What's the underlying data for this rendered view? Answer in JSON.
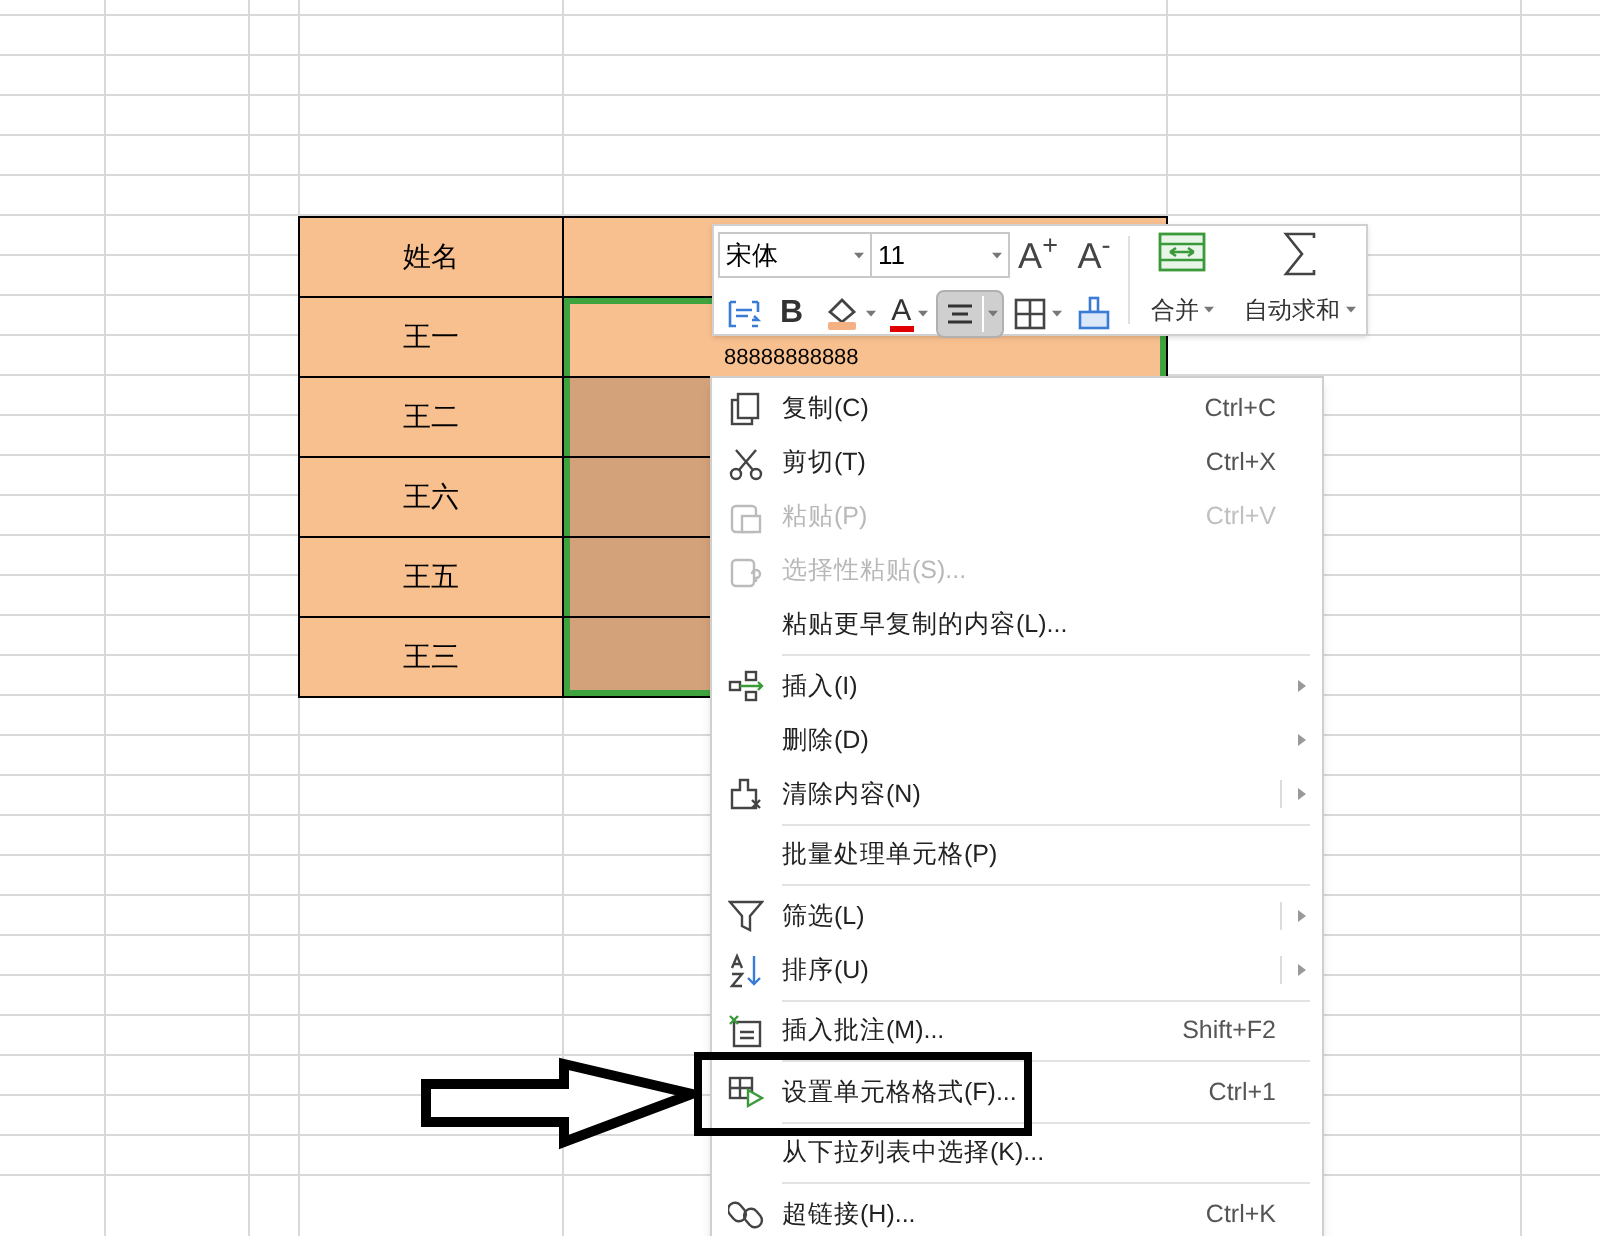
{
  "sheet": {
    "header": {
      "name": "姓名",
      "selected": false
    },
    "rows": [
      {
        "name": "王一",
        "value": "88888888888",
        "selected": true
      },
      {
        "name": "王二",
        "selected": true
      },
      {
        "name": "王六",
        "selected": true
      },
      {
        "name": "王五",
        "selected": true
      },
      {
        "name": "王三",
        "selected": true
      }
    ]
  },
  "toolbar": {
    "font": "宋体",
    "size": "11",
    "size_buttons": [
      "A$^{+}$",
      "A$^{-}$"
    ],
    "buttons": [
      {
        "kind": "wrap",
        "selected": false
      },
      {
        "kind": "bold",
        "label": "B",
        "selected": false
      },
      {
        "kind": "fill",
        "selected": false
      },
      {
        "kind": "fontcolor",
        "label": "A",
        "selected": false
      },
      {
        "kind": "align",
        "selected": true
      },
      {
        "kind": "border",
        "selected": false
      },
      {
        "kind": "painter",
        "selected": false
      }
    ],
    "merge": "合并",
    "autosum": "自动求和"
  },
  "menu": [
    {
      "kind": "copy",
      "label": "复制(C)",
      "shortcut": "Ctrl+C",
      "disabled": false,
      "submenu": false,
      "split": false
    },
    {
      "kind": "cut",
      "label": "剪切(T)",
      "shortcut": "Ctrl+X",
      "disabled": false,
      "submenu": false,
      "split": false
    },
    {
      "kind": "paste",
      "label": "粘贴(P)",
      "shortcut": "Ctrl+V",
      "disabled": true,
      "submenu": false,
      "split": false
    },
    {
      "kind": "pastespecial",
      "label": "选择性粘贴(S)...",
      "disabled": true,
      "submenu": false,
      "split": false
    },
    {
      "kind": "plain",
      "label": "粘贴更早复制的内容(L)...",
      "disabled": false,
      "submenu": false,
      "split": false
    },
    {
      "kind": "separator"
    },
    {
      "kind": "insert",
      "label": "插入(I)",
      "disabled": false,
      "submenu": true,
      "split": false
    },
    {
      "kind": "plain",
      "label": "删除(D)",
      "disabled": false,
      "submenu": true,
      "split": false
    },
    {
      "kind": "clear",
      "label": "清除内容(N)",
      "disabled": false,
      "submenu": true,
      "split": true
    },
    {
      "kind": "separator"
    },
    {
      "kind": "plain",
      "label": "批量处理单元格(P)",
      "disabled": false,
      "submenu": false,
      "split": false
    },
    {
      "kind": "separator"
    },
    {
      "kind": "filter",
      "label": "筛选(L)",
      "disabled": false,
      "submenu": true,
      "split": true
    },
    {
      "kind": "sort",
      "label": "排序(U)",
      "disabled": false,
      "submenu": true,
      "split": true
    },
    {
      "kind": "separator"
    },
    {
      "kind": "comment",
      "label": "插入批注(M)...",
      "shortcut": "Shift+F2",
      "disabled": false,
      "submenu": false,
      "split": false
    },
    {
      "kind": "separator"
    },
    {
      "kind": "format",
      "label": "设置单元格格式(F)...",
      "shortcut": "Ctrl+1",
      "disabled": false,
      "submenu": false,
      "split": false
    },
    {
      "kind": "separator"
    },
    {
      "kind": "plain",
      "label": "从下拉列表中选择(K)...",
      "disabled": false,
      "submenu": false,
      "split": false
    },
    {
      "kind": "separator"
    },
    {
      "kind": "link",
      "label": "超链接(H)...",
      "shortcut": "Ctrl+K",
      "disabled": false,
      "submenu": false,
      "split": false
    }
  ]
}
